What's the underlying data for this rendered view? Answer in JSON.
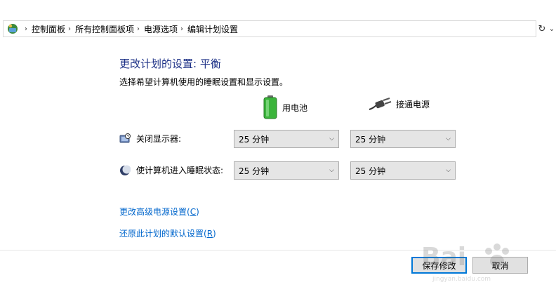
{
  "breadcrumb": {
    "items": [
      "控制面板",
      "所有控制面板项",
      "电源选项",
      "编辑计划设置"
    ]
  },
  "page": {
    "title": "更改计划的设置: 平衡",
    "subtitle": "选择希望计算机使用的睡眠设置和显示设置。"
  },
  "columns": {
    "battery_label": "用电池",
    "ac_label": "接通电源"
  },
  "settings": [
    {
      "label": "关闭显示器:",
      "battery_value": "25 分钟",
      "ac_value": "25 分钟"
    },
    {
      "label": "使计算机进入睡眠状态:",
      "battery_value": "25 分钟",
      "ac_value": "25 分钟"
    }
  ],
  "links": {
    "advanced_prefix": "更改高级电源设置(",
    "advanced_key": "C",
    "advanced_suffix": ")",
    "restore_prefix": "还原此计划的默认设置(",
    "restore_key": "R",
    "restore_suffix": ")"
  },
  "buttons": {
    "save": "保存修改",
    "cancel": "取消"
  },
  "watermark": {
    "text": "Bai",
    "sub": "jingyan.baidu.com"
  },
  "colors": {
    "title": "#1e3287",
    "link": "#0066cc",
    "focus": "#0078d7"
  }
}
